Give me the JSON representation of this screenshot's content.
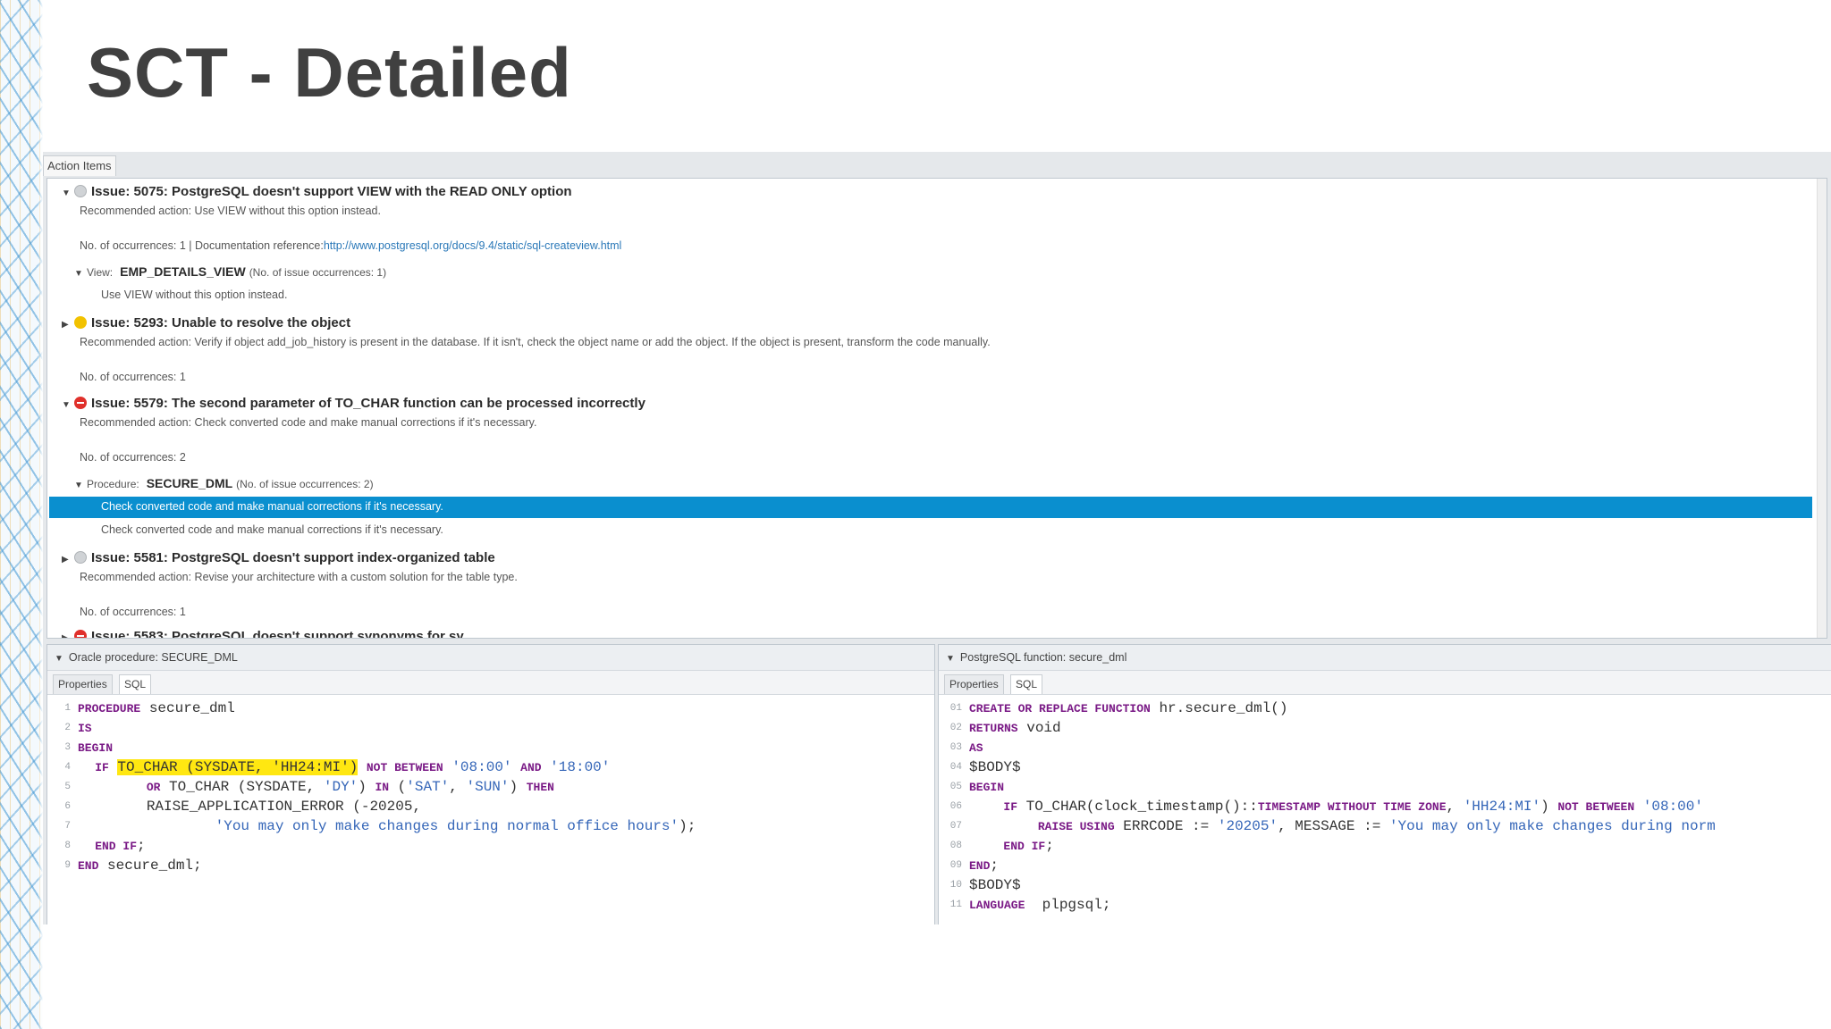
{
  "slide_title": "SCT - Detailed",
  "action_items_tab": "Action Items",
  "issues": [
    {
      "title": "Issue: 5075: PostgreSQL doesn't support VIEW with the READ ONLY option",
      "recommended": "Recommended action: Use VIEW without this option instead.",
      "occurrences": "No. of occurrences: 1 | Documentation reference:",
      "doc_link": "http://www.postgresql.org/docs/9.4/static/sql-createview.html",
      "node": {
        "type": "View:",
        "name": "EMP_DETAILS_VIEW",
        "count": "(No. of issue occurrences: 1)"
      },
      "node_items": [
        "Use VIEW without this option instead."
      ]
    },
    {
      "title": "Issue: 5293: Unable to resolve the object",
      "recommended": "Recommended action: Verify if object add_job_history is present in the database. If it isn't, check the object name or add the object. If the object is present, transform the code manually.",
      "occurrences": "No. of occurrences: 1"
    },
    {
      "title": "Issue: 5579: The second parameter of TO_CHAR function can be processed incorrectly",
      "recommended": "Recommended action: Check converted code and make manual corrections if it's necessary.",
      "occurrences": "No. of occurrences: 2",
      "node": {
        "type": "Procedure:",
        "name": "SECURE_DML",
        "count": "(No. of issue occurrences: 2)"
      },
      "node_items": [
        "Check converted code and make manual corrections if it's necessary.",
        "Check converted code and make manual corrections if it's necessary."
      ]
    },
    {
      "title": "Issue: 5581: PostgreSQL doesn't support index-organized table",
      "recommended": "Recommended action: Revise your architecture with a custom solution for the table type.",
      "occurrences": "No. of occurrences: 1"
    },
    {
      "title": "Issue: 5583: PostgreSQL doesn't support synonyms for sy..."
    }
  ],
  "oracle_panel": {
    "header": "Oracle procedure: SECURE_DML",
    "tabs": [
      "Properties",
      "SQL"
    ],
    "line_numbers": [
      "1",
      "2",
      "3",
      "4",
      "5",
      "6",
      "7",
      "8",
      "9"
    ],
    "lines": [
      [
        "PROCEDURE",
        " secure_dml"
      ],
      [
        "IS"
      ],
      [
        "BEGIN"
      ],
      [
        "  ",
        "IF",
        " ",
        "TO_CHAR (SYSDATE, 'HH24:MI')",
        " ",
        "NOT BETWEEN",
        " ",
        "'08:00'",
        " ",
        "AND",
        " ",
        "'18:00'"
      ],
      [
        "        ",
        "OR",
        " TO_CHAR (SYSDATE, ",
        "'DY'",
        ") ",
        "IN",
        " (",
        "'SAT'",
        ", ",
        "'SUN'",
        ") ",
        "THEN"
      ],
      [
        "        RAISE_APPLICATION_ERROR (-20205,"
      ],
      [
        "                ",
        "'You may only make changes during normal office hours'",
        ");"
      ],
      [
        "  ",
        "END IF",
        ";"
      ],
      [
        "END",
        " secure_dml;"
      ]
    ]
  },
  "pg_panel": {
    "header": "PostgreSQL function: secure_dml",
    "tabs": [
      "Properties",
      "SQL"
    ],
    "line_numbers": [
      "01",
      "02",
      "03",
      "04",
      "05",
      "06",
      "07",
      "08",
      "09",
      "10",
      "11"
    ],
    "lines": [
      [
        "CREATE OR REPLACE FUNCTION",
        " hr.secure_dml()"
      ],
      [
        "RETURNS",
        " void"
      ],
      [
        "AS"
      ],
      [
        "$BODY$"
      ],
      [
        "BEGIN"
      ],
      [
        "    ",
        "IF",
        " TO_CHAR(clock_timestamp()::",
        "TIMESTAMP WITHOUT TIME ZONE",
        ", ",
        "'HH24:MI'",
        ") ",
        "NOT BETWEEN",
        " ",
        "'08:00'"
      ],
      [
        "        ",
        "RAISE USING",
        " ERRCODE := ",
        "'20205'",
        ", MESSAGE := ",
        "'You may only make changes during norm"
      ],
      [
        "    ",
        "END IF",
        ";"
      ],
      [
        "END",
        ";"
      ],
      [
        "$BODY$"
      ],
      [
        "LANGUAGE",
        "  plpgsql;"
      ]
    ]
  },
  "colors": {
    "selection": "#0a8fcf",
    "keyword": "#7a1a86",
    "string": "#3566b8",
    "highlight": "#ffe711",
    "error": "#e0302b",
    "warning": "#f2c200"
  }
}
